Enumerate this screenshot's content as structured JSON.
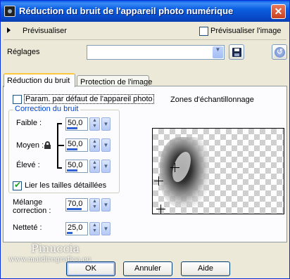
{
  "window": {
    "title": "Réduction du bruit de l'appareil photo numérique",
    "close_glyph": "✕"
  },
  "toprow": {
    "preview_label": "Prévisualiser",
    "preview_image_label": "Prévisualiser l'image"
  },
  "settings": {
    "label": "Réglages",
    "value": ""
  },
  "tabs": [
    {
      "label": "Réduction du bruit"
    },
    {
      "label": "Protection de l'image"
    }
  ],
  "noise": {
    "default_param_label": "Param. par défaut de l'appareil photo",
    "group_label": "Correction du bruit",
    "low_label": "Faible :",
    "low_value": "50,0",
    "medium_label": "Moyen :",
    "medium_value": "50,0",
    "high_label": "Élevé :",
    "high_value": "50,0",
    "link_label": "Lier les tailles détaillées",
    "mix_label_line1": "Mélange",
    "mix_label_line2": "correction :",
    "mix_value": "70,0",
    "sharpness_label": "Netteté :",
    "sharpness_value": "25,0",
    "levels": {
      "low": 0.5,
      "medium": 0.5,
      "high": 0.5,
      "mix": 0.7,
      "sharpness": 0.25
    }
  },
  "sampling": {
    "label": "Zones d'échantillonnage"
  },
  "buttons": {
    "ok": "OK",
    "cancel": "Annuler",
    "help": "Aide"
  },
  "watermark": {
    "name": "Pinuccia",
    "site": "www.maidiregrafica.eu"
  },
  "colors": {
    "accent": "#2f63d3",
    "group_label": "#0046d5",
    "titlebar": "#0a5ae8"
  }
}
